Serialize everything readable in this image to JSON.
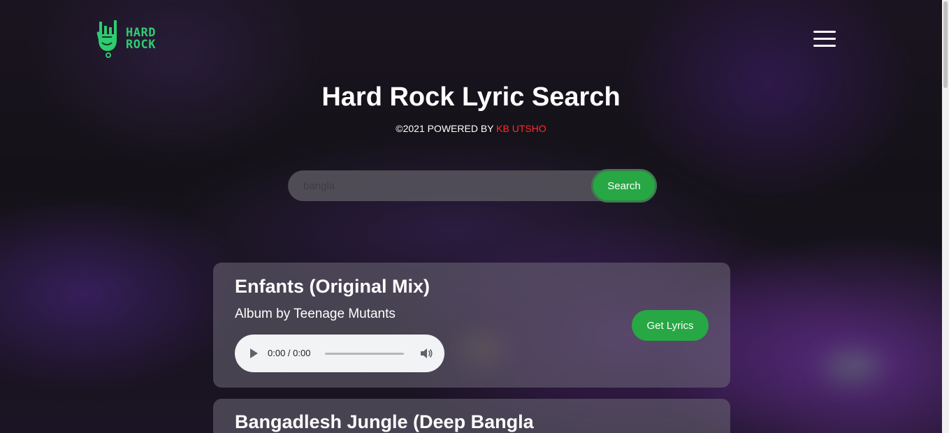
{
  "header": {
    "logo_line1": "HARD",
    "logo_line2": "ROCK"
  },
  "hero": {
    "title": "Hard Rock Lyric Search",
    "subtitle_prefix": "©2021 POWERED BY ",
    "subtitle_author": "KB UTSHO"
  },
  "search": {
    "value": "",
    "placeholder": "bangla",
    "button_label": "Search"
  },
  "results": [
    {
      "title": "Enfants (Original Mix)",
      "artist_line": "Album by Teenage Mutants",
      "audio_time": "0:00 / 0:00",
      "button_label": "Get Lyrics"
    },
    {
      "title": "Bangadlesh Jungle (Deep Bangla"
    }
  ],
  "colors": {
    "accent_green": "#28a745",
    "logo_green": "#2ecc71",
    "author_red": "#ff2a2a"
  }
}
